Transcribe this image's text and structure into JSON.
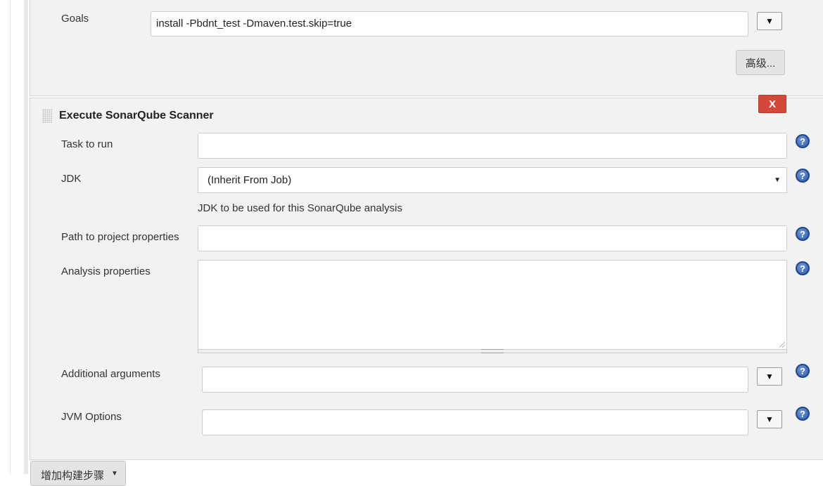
{
  "maven": {
    "goals_label": "Goals",
    "goals_value": "install -Pbdnt_test -Dmaven.test.skip=true",
    "advanced_label": "高级..."
  },
  "sonar": {
    "section_title": "Execute SonarQube Scanner",
    "delete_label": "X",
    "task_label": "Task to run",
    "task_value": "",
    "jdk_label": "JDK",
    "jdk_selected": "(Inherit From Job)",
    "jdk_description": "JDK to be used for this SonarQube analysis",
    "path_label": "Path to project properties",
    "path_value": "",
    "analysis_label": "Analysis properties",
    "analysis_value": "",
    "additional_label": "Additional arguments",
    "additional_value": "",
    "jvm_label": "JVM Options",
    "jvm_value": ""
  },
  "footer": {
    "add_step_label": "增加构建步骤"
  },
  "icons": {
    "dropdown": "triangle-down-icon",
    "help": "question-mark-help-icon",
    "drag": "drag-handle-icon"
  },
  "colors": {
    "panel_bg": "#f2f2f2",
    "delete_red": "#d24939",
    "help_blue": "#2f5bab"
  }
}
